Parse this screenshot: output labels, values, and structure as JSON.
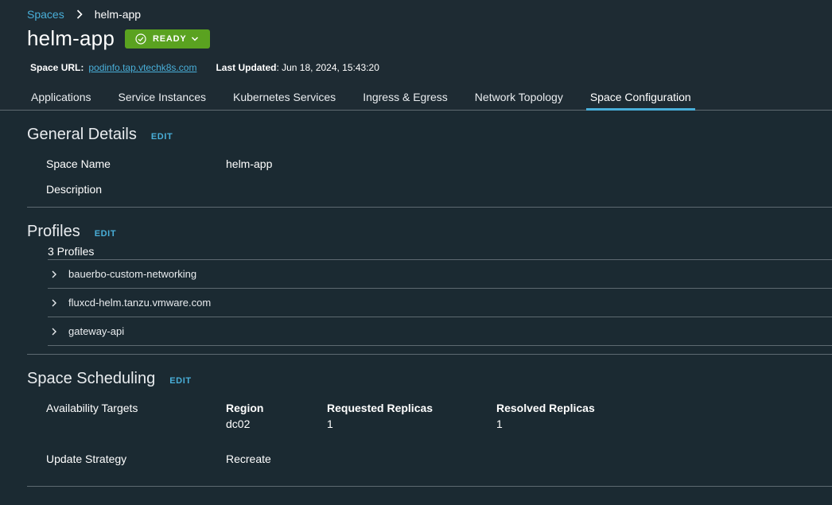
{
  "breadcrumb": {
    "parent": "Spaces",
    "current": "helm-app"
  },
  "space": {
    "title": "helm-app",
    "status": "READY"
  },
  "meta": {
    "url_label": "Space URL:",
    "url_value": "podinfo.tap.vtechk8s.com",
    "updated_label": "Last Updated",
    "updated_value": ": Jun 18, 2024, 15:43:20"
  },
  "tabs": [
    {
      "label": "Applications"
    },
    {
      "label": "Service Instances"
    },
    {
      "label": "Kubernetes Services"
    },
    {
      "label": "Ingress & Egress"
    },
    {
      "label": "Network Topology"
    },
    {
      "label": "Space Configuration"
    }
  ],
  "general": {
    "title": "General Details",
    "edit": "EDIT",
    "name_label": "Space Name",
    "name_value": "helm-app",
    "desc_label": "Description"
  },
  "profiles": {
    "title": "Profiles",
    "edit": "EDIT",
    "count": "3 Profiles",
    "items": [
      {
        "name": "bauerbo-custom-networking"
      },
      {
        "name": "fluxcd-helm.tanzu.vmware.com"
      },
      {
        "name": "gateway-api"
      }
    ]
  },
  "scheduling": {
    "title": "Space Scheduling",
    "edit": "EDIT",
    "targets_label": "Availability Targets",
    "columns": {
      "region": "Region",
      "requested": "Requested Replicas",
      "resolved": "Resolved Replicas"
    },
    "row": {
      "region": "dc02",
      "requested": "1",
      "resolved": "1"
    },
    "strategy_label": "Update Strategy",
    "strategy_value": "Recreate"
  },
  "colors": {
    "accent": "#49afd9",
    "status_green": "#5aa220",
    "background": "#1b2a32"
  },
  "icons": {
    "breadcrumb_separator": "chevron-right-icon",
    "status": "check-circle-icon",
    "status_dropdown": "chevron-down-icon",
    "profile_expand": "chevron-right-icon"
  }
}
